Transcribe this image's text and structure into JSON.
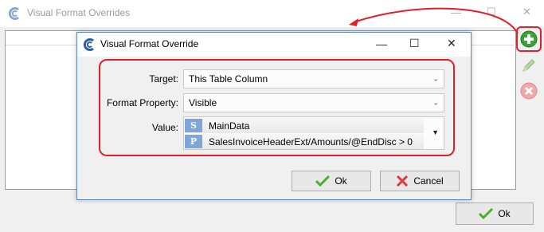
{
  "outer_window": {
    "title": "Visual Format Overrides",
    "ok_label": "Ok",
    "window_buttons": {
      "minimize": "—",
      "maximize": "☐",
      "close": "✕"
    },
    "toolbar": [
      "add-icon",
      "edit-icon",
      "delete-icon"
    ]
  },
  "dialog": {
    "title": "Visual Format Override",
    "window_buttons": {
      "minimize": "—",
      "maximize": "☐",
      "close": "✕"
    },
    "fields": {
      "target": {
        "label": "Target:",
        "value": "This Table Column"
      },
      "format_property": {
        "label": "Format Property:",
        "value": "Visible"
      },
      "value": {
        "label": "Value:",
        "items": [
          {
            "badge": "S",
            "text": "MainData"
          },
          {
            "badge": "P",
            "text": "SalesInvoiceHeaderExt/Amounts/@EndDisc > 0"
          }
        ]
      }
    },
    "ok_label": "Ok",
    "cancel_label": "Cancel"
  },
  "colors": {
    "annotation": "#e0202a",
    "badge": "#7ea6d6",
    "add_green": "#3aa33a",
    "dialog_border": "#5a8ac6"
  }
}
